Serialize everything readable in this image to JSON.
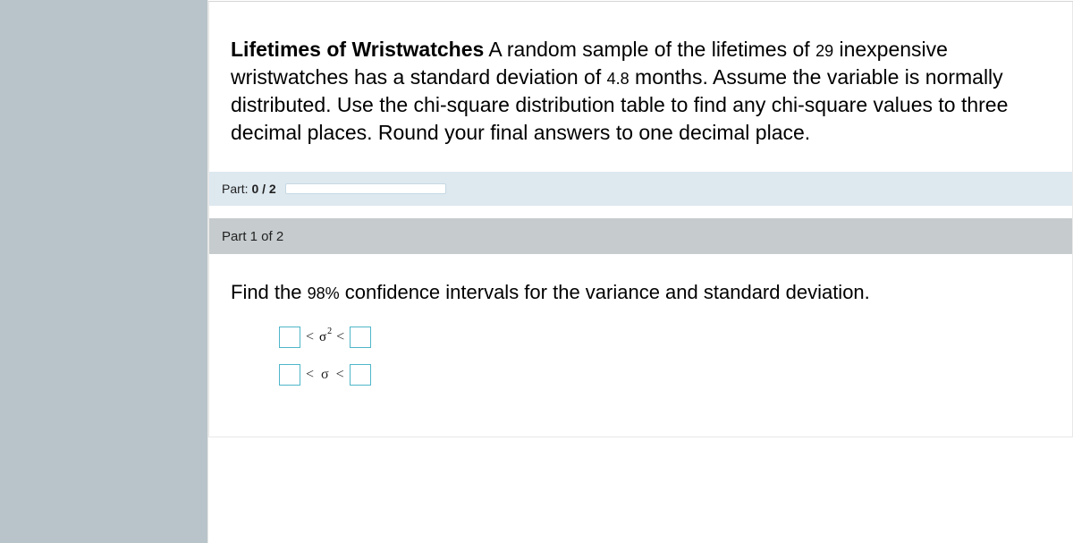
{
  "problem": {
    "title_bold": "Lifetimes of Wristwatches",
    "sentence_lead": " A random sample of the lifetimes of ",
    "sample_n": "29",
    "sentence_mid1": " inexpensive wristwatches has a standard deviation of ",
    "std_dev": "4.8",
    "sentence_tail": " months. Assume the variable is normally distributed. Use the chi-square distribution table to find any chi-square values to three decimal places. Round your final answers to one decimal place."
  },
  "progress": {
    "prefix": "Part: ",
    "value": "0 / 2"
  },
  "part_header": {
    "label": "Part 1 of 2"
  },
  "part_question": {
    "lead": "Find the ",
    "pct": "98%",
    "tail": " confidence intervals for the variance and standard deviation."
  },
  "symbols": {
    "lt": "<",
    "sigma": "σ",
    "sq": "2"
  }
}
